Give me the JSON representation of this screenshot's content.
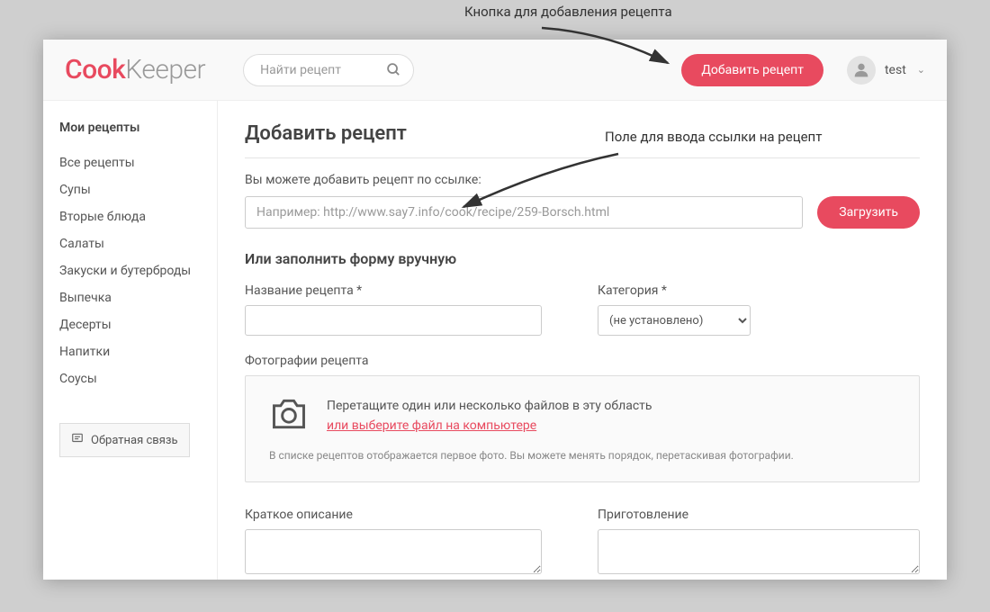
{
  "annotations": {
    "top": "Кнопка для добавления рецепта",
    "mid": "Поле для ввода ссылки на рецепт"
  },
  "logo": {
    "part1": "Cook",
    "part2": "Keeper"
  },
  "search": {
    "placeholder": "Найти рецепт"
  },
  "header": {
    "add_button": "Добавить рецепт",
    "user_name": "test"
  },
  "sidebar": {
    "title": "Мои рецепты",
    "items": [
      "Все рецепты",
      "Супы",
      "Вторые блюда",
      "Салаты",
      "Закуски и бутерброды",
      "Выпечка",
      "Десерты",
      "Напитки",
      "Соусы"
    ],
    "feedback": "Обратная связь"
  },
  "main": {
    "title": "Добавить рецепт",
    "url_label": "Вы можете добавить рецепт по ссылке:",
    "url_placeholder": "Например: http://www.say7.info/cook/recipe/259-Borsch.html",
    "load_button": "Загрузить",
    "manual_title": "Или заполнить форму вручную",
    "name_label": "Название рецепта *",
    "category_label": "Категория *",
    "category_value": "(не установлено)",
    "photos_label": "Фотографии рецепта",
    "dropzone_text": "Перетащите один или несколько файлов в эту область",
    "dropzone_link": "или выберите файл на компьютере",
    "dropzone_hint": "В списке рецептов отображается первое фото. Вы можете менять порядок, перетаскивая фотографии.",
    "short_desc_label": "Краткое описание",
    "preparation_label": "Приготовление"
  }
}
